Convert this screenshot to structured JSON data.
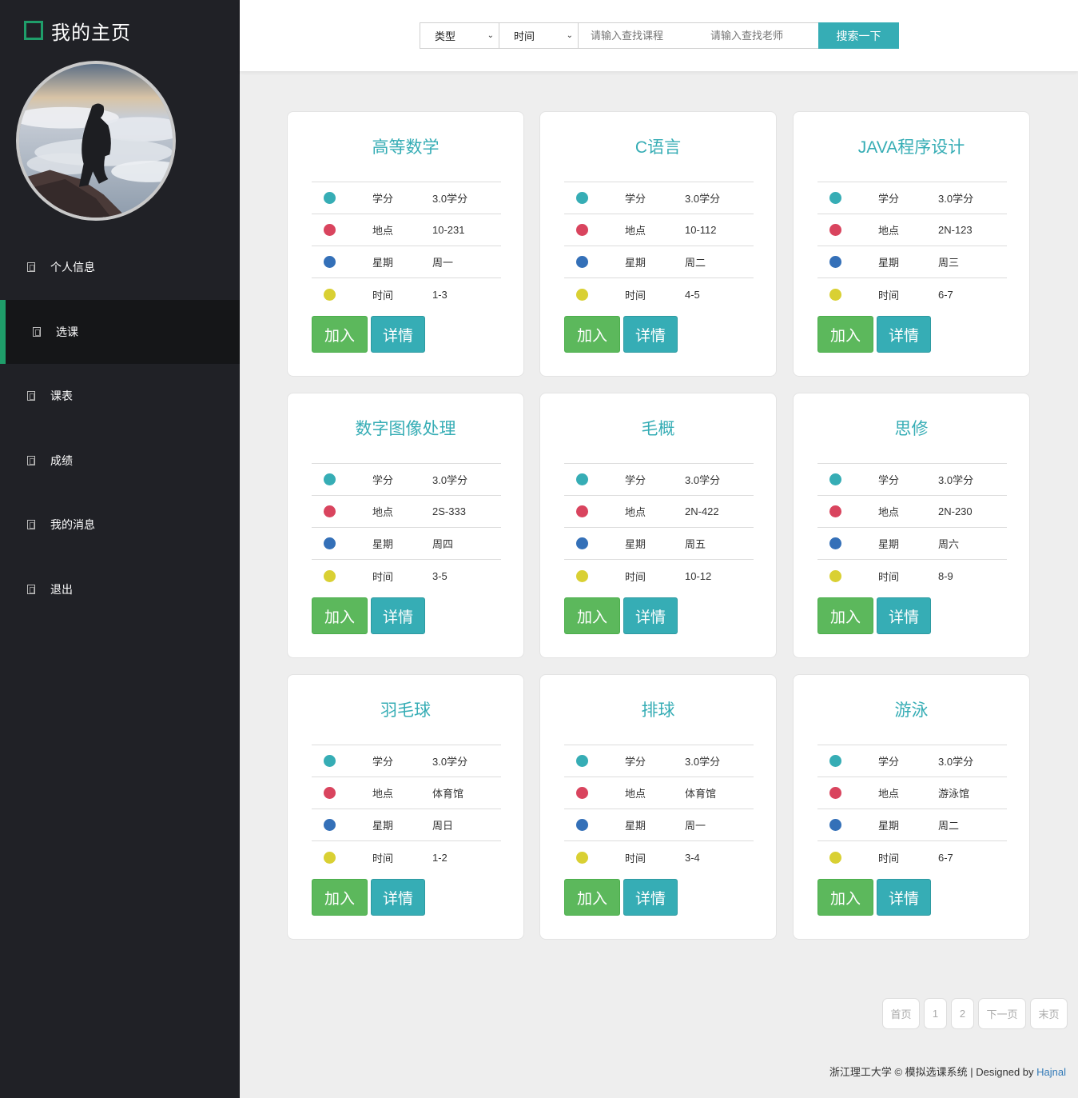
{
  "sidebar": {
    "brand_title": "我的主页",
    "nav": [
      {
        "label": "个人信息",
        "active": false
      },
      {
        "label": "选课",
        "active": true
      },
      {
        "label": "课表",
        "active": false
      },
      {
        "label": "成绩",
        "active": false
      },
      {
        "label": "我的消息",
        "active": false
      },
      {
        "label": "退出",
        "active": false
      }
    ]
  },
  "search": {
    "type_select": "类型",
    "time_select": "时间",
    "course_placeholder": "请输入查找课程",
    "teacher_placeholder": "请输入查找老师",
    "button": "搜索一下"
  },
  "labels": {
    "credit": "学分",
    "location": "地点",
    "weekday": "星期",
    "time": "时间",
    "join": "加入",
    "detail": "详情"
  },
  "dot_colors": [
    "#36adb5",
    "#d9445e",
    "#3470b8",
    "#d9d033"
  ],
  "courses": [
    {
      "name": "高等数学",
      "credit": "3.0学分",
      "location": "10-231",
      "weekday": "周一",
      "time": "1-3"
    },
    {
      "name": "C语言",
      "credit": "3.0学分",
      "location": "10-112",
      "weekday": "周二",
      "time": "4-5"
    },
    {
      "name": "JAVA程序设计",
      "credit": "3.0学分",
      "location": "2N-123",
      "weekday": "周三",
      "time": "6-7"
    },
    {
      "name": "数字图像处理",
      "credit": "3.0学分",
      "location": "2S-333",
      "weekday": "周四",
      "time": "3-5"
    },
    {
      "name": "毛概",
      "credit": "3.0学分",
      "location": "2N-422",
      "weekday": "周五",
      "time": "10-12"
    },
    {
      "name": "思修",
      "credit": "3.0学分",
      "location": "2N-230",
      "weekday": "周六",
      "time": "8-9"
    },
    {
      "name": "羽毛球",
      "credit": "3.0学分",
      "location": "体育馆",
      "weekday": "周日",
      "time": "1-2"
    },
    {
      "name": "排球",
      "credit": "3.0学分",
      "location": "体育馆",
      "weekday": "周一",
      "time": "3-4"
    },
    {
      "name": "游泳",
      "credit": "3.0学分",
      "location": "游泳馆",
      "weekday": "周二",
      "time": "6-7"
    }
  ],
  "pagination": {
    "first": "首页",
    "pages": [
      "1",
      "2"
    ],
    "next": "下一页",
    "last": "末页"
  },
  "footer": {
    "text": "浙江理工大学 © 模拟选课系统 | Designed by ",
    "author": "Hajnal"
  }
}
